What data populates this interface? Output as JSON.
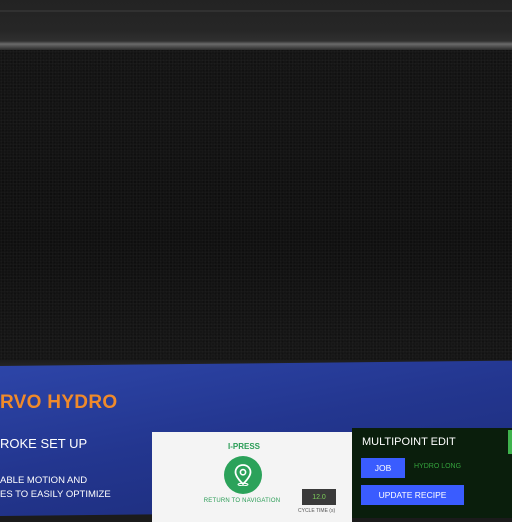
{
  "app": {
    "title": "RVO HYDRO"
  },
  "setup": {
    "section_title": "ROKE SET UP",
    "description_lines": [
      "ABLE MOTION AND",
      "ES TO EASILY OPTIMIZE"
    ]
  },
  "card": {
    "title": "I-PRESS",
    "nav_icon": "location-pin-icon",
    "nav_label": "RETURN TO NAVIGATION",
    "time_value": "12.0",
    "time_caption": "CYCLE TIME (s)"
  },
  "multipoint": {
    "title": "MULTIPOINT EDIT",
    "job_button": "JOB",
    "job_value": "HYDRO LONG",
    "update_button": "UPDATE RECIPE"
  },
  "colors": {
    "screen_blue": "#23368f",
    "title_orange": "#f08a2a",
    "accent_green": "#2ba25a",
    "button_blue": "#3a5cff",
    "panel_dark_green": "#0a1e0c"
  }
}
